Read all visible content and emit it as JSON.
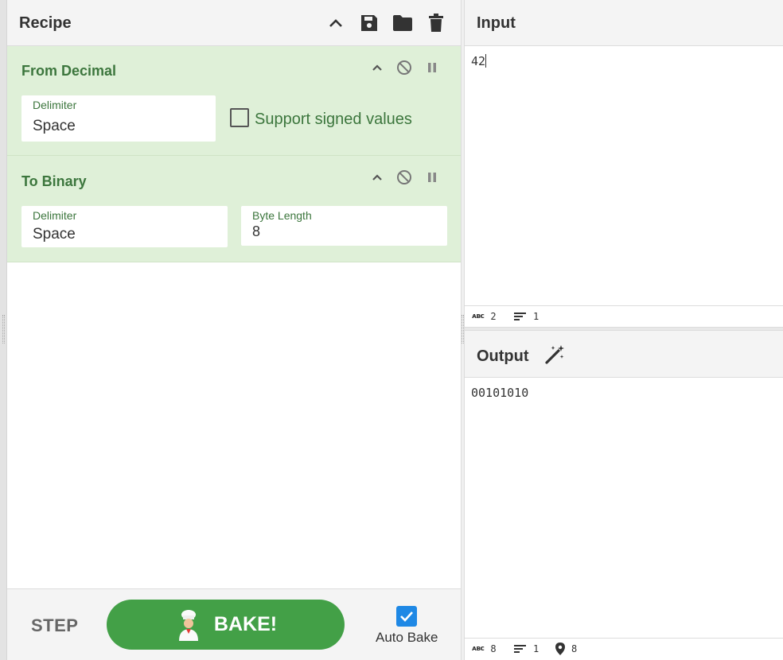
{
  "recipe": {
    "title": "Recipe",
    "header_icons": [
      "chevron-up-icon",
      "save-icon",
      "folder-icon",
      "trash-icon"
    ],
    "operations": [
      {
        "title": "From Decimal",
        "fields": [
          {
            "label": "Delimiter",
            "value": "Space"
          }
        ],
        "checkbox": {
          "label": "Support signed values",
          "checked": false
        }
      },
      {
        "title": "To Binary",
        "fields": [
          {
            "label": "Delimiter",
            "value": "Space"
          },
          {
            "label": "Byte Length",
            "value": "8"
          }
        ]
      }
    ]
  },
  "controls": {
    "step_label": "STEP",
    "bake_label": "BAKE!",
    "auto_bake_label": "Auto Bake",
    "auto_bake_checked": true
  },
  "input": {
    "title": "Input",
    "text": "42",
    "stats": {
      "length": "2",
      "lines": "1"
    }
  },
  "output": {
    "title": "Output",
    "text": "00101010",
    "stats": {
      "length": "8",
      "lines": "1",
      "position": "8"
    }
  },
  "colors": {
    "op_bg": "#dff0d8",
    "op_text": "#3c763d",
    "bake": "#43a047",
    "checkbox_blue": "#1e88e5"
  }
}
